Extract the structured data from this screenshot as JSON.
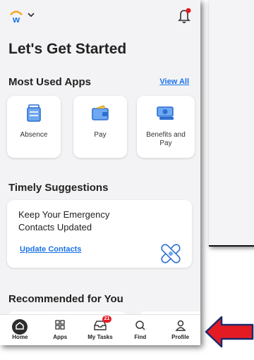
{
  "header": {
    "logo_letter": "w",
    "notification_dot": "#e41b23"
  },
  "page_title": "Let's Get Started",
  "most_used": {
    "title": "Most Used Apps",
    "view_all": "View All",
    "apps": [
      {
        "label": "Absence",
        "icon": "luggage-icon"
      },
      {
        "label": "Pay",
        "icon": "wallet-icon"
      },
      {
        "label": "Benefits and Pay",
        "icon": "money-icon"
      }
    ]
  },
  "timely": {
    "title": "Timely Suggestions",
    "card_text": "Keep Your Emergency Contacts Updated",
    "link": "Update Contacts"
  },
  "recommended": {
    "title": "Recommended for You"
  },
  "tabs": [
    {
      "label": "Home",
      "icon": "home-icon"
    },
    {
      "label": "Apps",
      "icon": "apps-grid-icon"
    },
    {
      "label": "My Tasks",
      "icon": "inbox-icon",
      "badge": "21"
    },
    {
      "label": "Find",
      "icon": "search-icon"
    },
    {
      "label": "Profile",
      "icon": "person-icon"
    }
  ],
  "colors": {
    "accent": "#1a73e8",
    "brand_orange": "#f5a623",
    "arrow": "#e41b23"
  }
}
